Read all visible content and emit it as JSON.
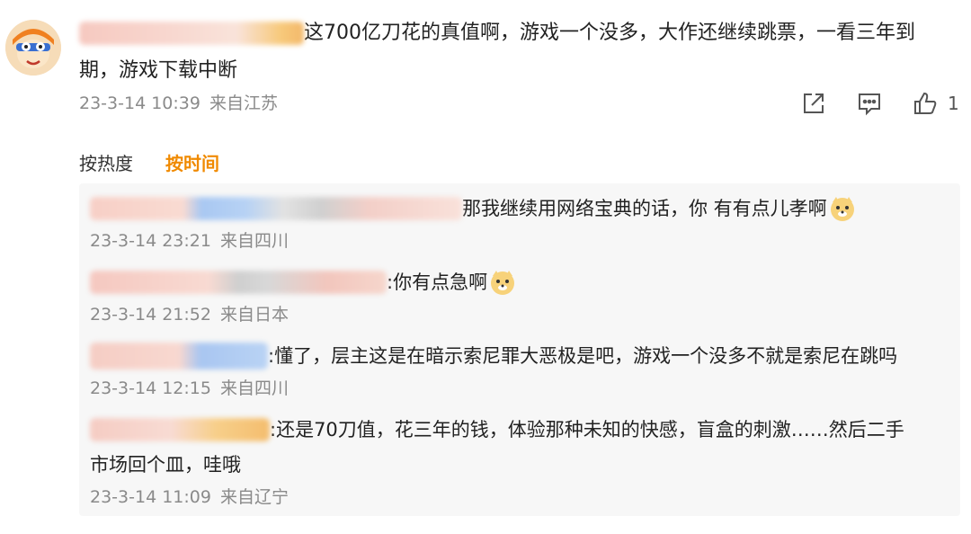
{
  "comment": {
    "text": "这700亿刀花的真值啊，游戏一个没多，大作还继续跳票，一看三年到期，游戏下载中断",
    "time": "23-3-14 10:39",
    "location": "来自江苏",
    "like_count": "1"
  },
  "sort": {
    "by_heat": "按热度",
    "by_time": "按时间"
  },
  "replies": [
    {
      "text": "那我继续用网络宝典的话，你 有有点儿孝啊",
      "time": "23-3-14 23:21",
      "location": "来自四川",
      "emoji": "doge-emoji"
    },
    {
      "text": ":你有点急啊",
      "time": "23-3-14 21:52",
      "location": "来自日本",
      "emoji": "doge-emoji"
    },
    {
      "text": ":懂了，层主这是在暗示索尼罪大恶极是吧，游戏一个没多不就是索尼在跳吗",
      "time": "23-3-14 12:15",
      "location": "来自四川"
    },
    {
      "text": ":还是70刀值，花三年的钱，体验那种未知的快感，盲盒的刺激……然后二手",
      "text2": "市场回个皿，哇哦",
      "time": "23-3-14 11:09",
      "location": "来自辽宁"
    }
  ],
  "colors": {
    "accent": "#f08a00",
    "meta": "#8a8a8a",
    "reply_bg": "#f7f7f7"
  }
}
